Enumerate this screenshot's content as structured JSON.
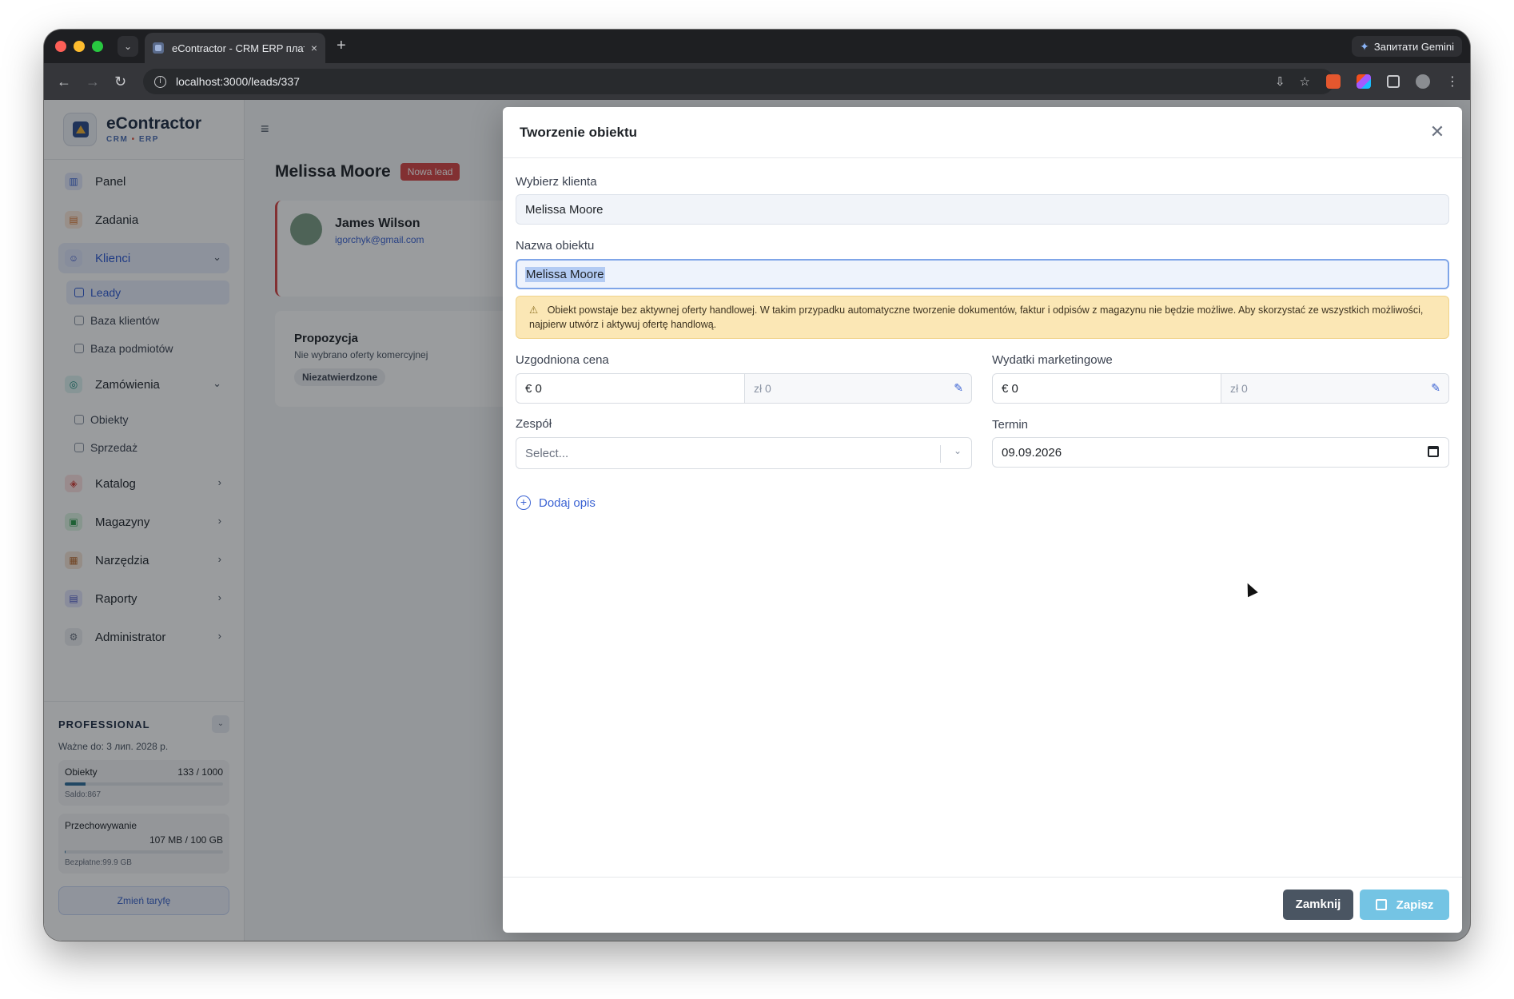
{
  "browser": {
    "tab_title": "eContractor - CRM ERP плат",
    "tab_close": "×",
    "new_tab": "+",
    "url": "localhost:3000/leads/337",
    "gemini_label": "Запитати Gemini"
  },
  "sidebar": {
    "brand_name": "eContractor",
    "brand_sub_left": "CRM",
    "brand_sub_dot": "•",
    "brand_sub_right": "ERP",
    "items": [
      {
        "label": "Panel"
      },
      {
        "label": "Zadania"
      },
      {
        "label": "Klienci"
      },
      {
        "label": "Zamówienia"
      },
      {
        "label": "Katalog"
      },
      {
        "label": "Magazyny"
      },
      {
        "label": "Narzędzia"
      },
      {
        "label": "Raporty"
      },
      {
        "label": "Administrator"
      }
    ],
    "sub_klienci": [
      {
        "label": "Leady"
      },
      {
        "label": "Baza klientów"
      },
      {
        "label": "Baza podmiotów"
      }
    ],
    "sub_zamowienia": [
      {
        "label": "Obiekty"
      },
      {
        "label": "Sprzedaż"
      }
    ],
    "plan": {
      "name": "PROFESSIONAL",
      "valid": "Ważne do: 3 лип. 2028 р.",
      "objects_label": "Obiekty",
      "objects_value": "133 / 1000",
      "objects_fraction": 0.133,
      "objects_note": "Saldo:867",
      "storage_label": "Przechowywanie",
      "storage_value": "107 MB / 100 GB",
      "storage_fraction": 0.001,
      "storage_note": "Bezpłatne:99.9 GB",
      "change_label": "Zmień taryfę"
    }
  },
  "lead": {
    "name": "Melissa Moore",
    "badge": "Nowa lead",
    "contact_name": "James Wilson",
    "contact_email": "igorchyk@gmail.com",
    "proposal_title": "Propozycja",
    "proposal_sub": "Nie wybrano oferty komercyjnej",
    "proposal_badge": "Niezatwierdzone"
  },
  "modal": {
    "title": "Tworzenie obiektu",
    "client_label": "Wybierz klienta",
    "client_value": "Melissa Moore",
    "object_name_label": "Nazwa obiektu",
    "object_name_value": "Melissa Moore",
    "alert_text": "Obiekt powstaje bez aktywnej oferty handlowej. W takim przypadku automatyczne tworzenie dokumentów, faktur i odpisów z magazynu nie będzie możliwe. Aby skorzystać ze wszystkich możliwości, najpierw utwórz i aktywuj ofertę handlową.",
    "price_label": "Uzgodniona cena",
    "price_value": "€ 0",
    "price_pln": "zł 0",
    "marketing_label": "Wydatki marketingowe",
    "marketing_value": "€ 0",
    "marketing_pln": "zł 0",
    "team_label": "Zespół",
    "team_placeholder": "Select...",
    "deadline_label": "Termin",
    "deadline_value": "09.09.2026",
    "add_desc_label": "Dodaj opis",
    "close_button": "Zamknij",
    "save_button": "Zapisz"
  },
  "colors": {
    "accent": "#3b63d3",
    "danger": "#d64545",
    "warning_bg": "#fbe7b5",
    "save_button": "#74c4e4",
    "close_button": "#4a5562"
  }
}
